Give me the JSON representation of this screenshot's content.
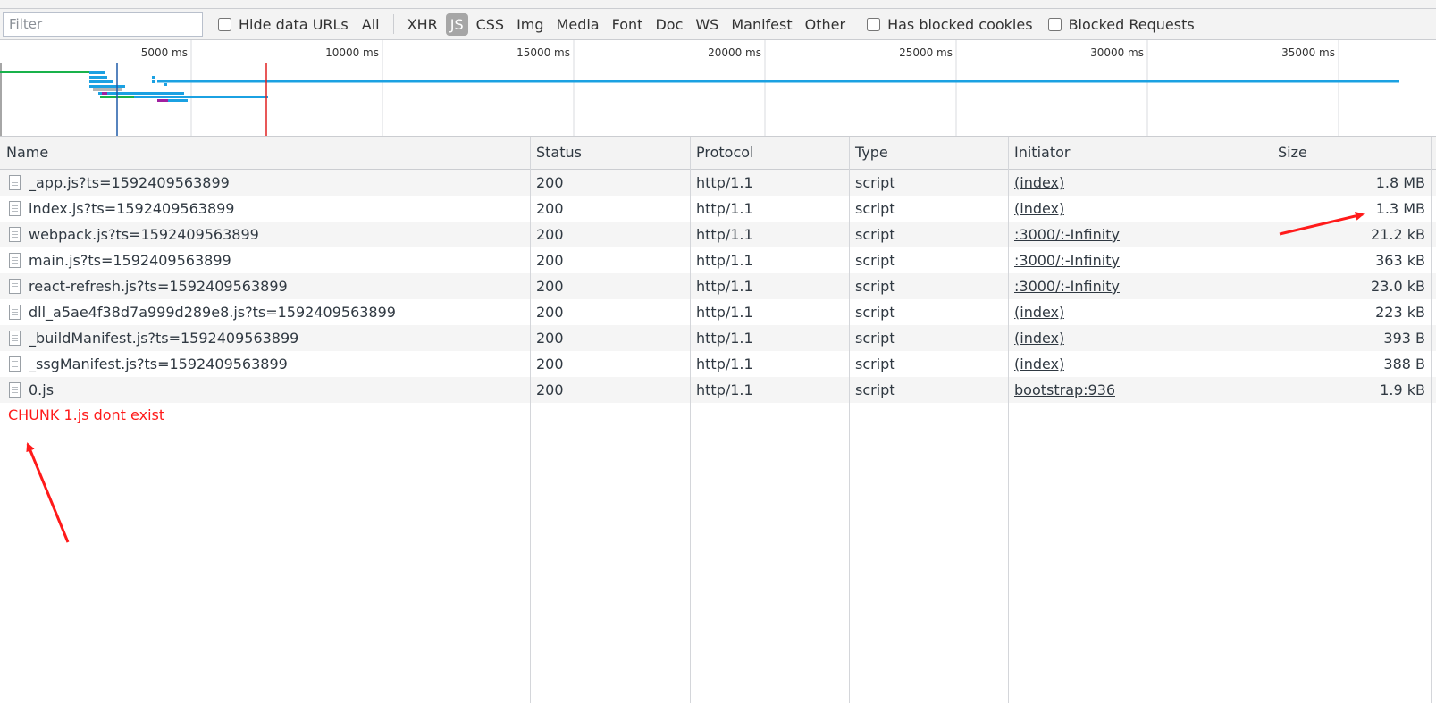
{
  "toolbar": {
    "filter_placeholder": "Filter",
    "hide_data_urls_label": "Hide data URLs",
    "types": [
      "All",
      "XHR",
      "JS",
      "CSS",
      "Img",
      "Media",
      "Font",
      "Doc",
      "WS",
      "Manifest",
      "Other"
    ],
    "active_type": "JS",
    "has_blocked_cookies_label": "Has blocked cookies",
    "blocked_requests_label": "Blocked Requests"
  },
  "timeline": {
    "ticks": [
      "5000 ms",
      "10000 ms",
      "15000 ms",
      "20000 ms",
      "25000 ms",
      "30000 ms",
      "35000 ms"
    ],
    "colors": {
      "blue": "#1ba1e2",
      "green": "#19b24b",
      "red": "#e02020",
      "grid": "#d9dbdf"
    }
  },
  "table": {
    "columns": [
      "Name",
      "Status",
      "Protocol",
      "Type",
      "Initiator",
      "Size"
    ],
    "rows": [
      {
        "name": "_app.js?ts=1592409563899",
        "status": "200",
        "protocol": "http/1.1",
        "type": "script",
        "initiator": "(index)",
        "size": "1.8 MB"
      },
      {
        "name": "index.js?ts=1592409563899",
        "status": "200",
        "protocol": "http/1.1",
        "type": "script",
        "initiator": "(index)",
        "size": "1.3 MB"
      },
      {
        "name": "webpack.js?ts=1592409563899",
        "status": "200",
        "protocol": "http/1.1",
        "type": "script",
        "initiator": ":3000/:-Infinity",
        "size": "21.2 kB"
      },
      {
        "name": "main.js?ts=1592409563899",
        "status": "200",
        "protocol": "http/1.1",
        "type": "script",
        "initiator": ":3000/:-Infinity",
        "size": "363 kB"
      },
      {
        "name": "react-refresh.js?ts=1592409563899",
        "status": "200",
        "protocol": "http/1.1",
        "type": "script",
        "initiator": ":3000/:-Infinity",
        "size": "23.0 kB"
      },
      {
        "name": "dll_a5ae4f38d7a999d289e8.js?ts=1592409563899",
        "status": "200",
        "protocol": "http/1.1",
        "type": "script",
        "initiator": "(index)",
        "size": "223 kB"
      },
      {
        "name": "_buildManifest.js?ts=1592409563899",
        "status": "200",
        "protocol": "http/1.1",
        "type": "script",
        "initiator": "(index)",
        "size": "393 B"
      },
      {
        "name": "_ssgManifest.js?ts=1592409563899",
        "status": "200",
        "protocol": "http/1.1",
        "type": "script",
        "initiator": "(index)",
        "size": "388 B"
      },
      {
        "name": "0.js",
        "status": "200",
        "protocol": "http/1.1",
        "type": "script",
        "initiator": "bootstrap:936",
        "size": "1.9 kB"
      }
    ]
  },
  "annotation": {
    "text": "CHUNK 1.js dont exist",
    "color": "#ff1a1a"
  }
}
